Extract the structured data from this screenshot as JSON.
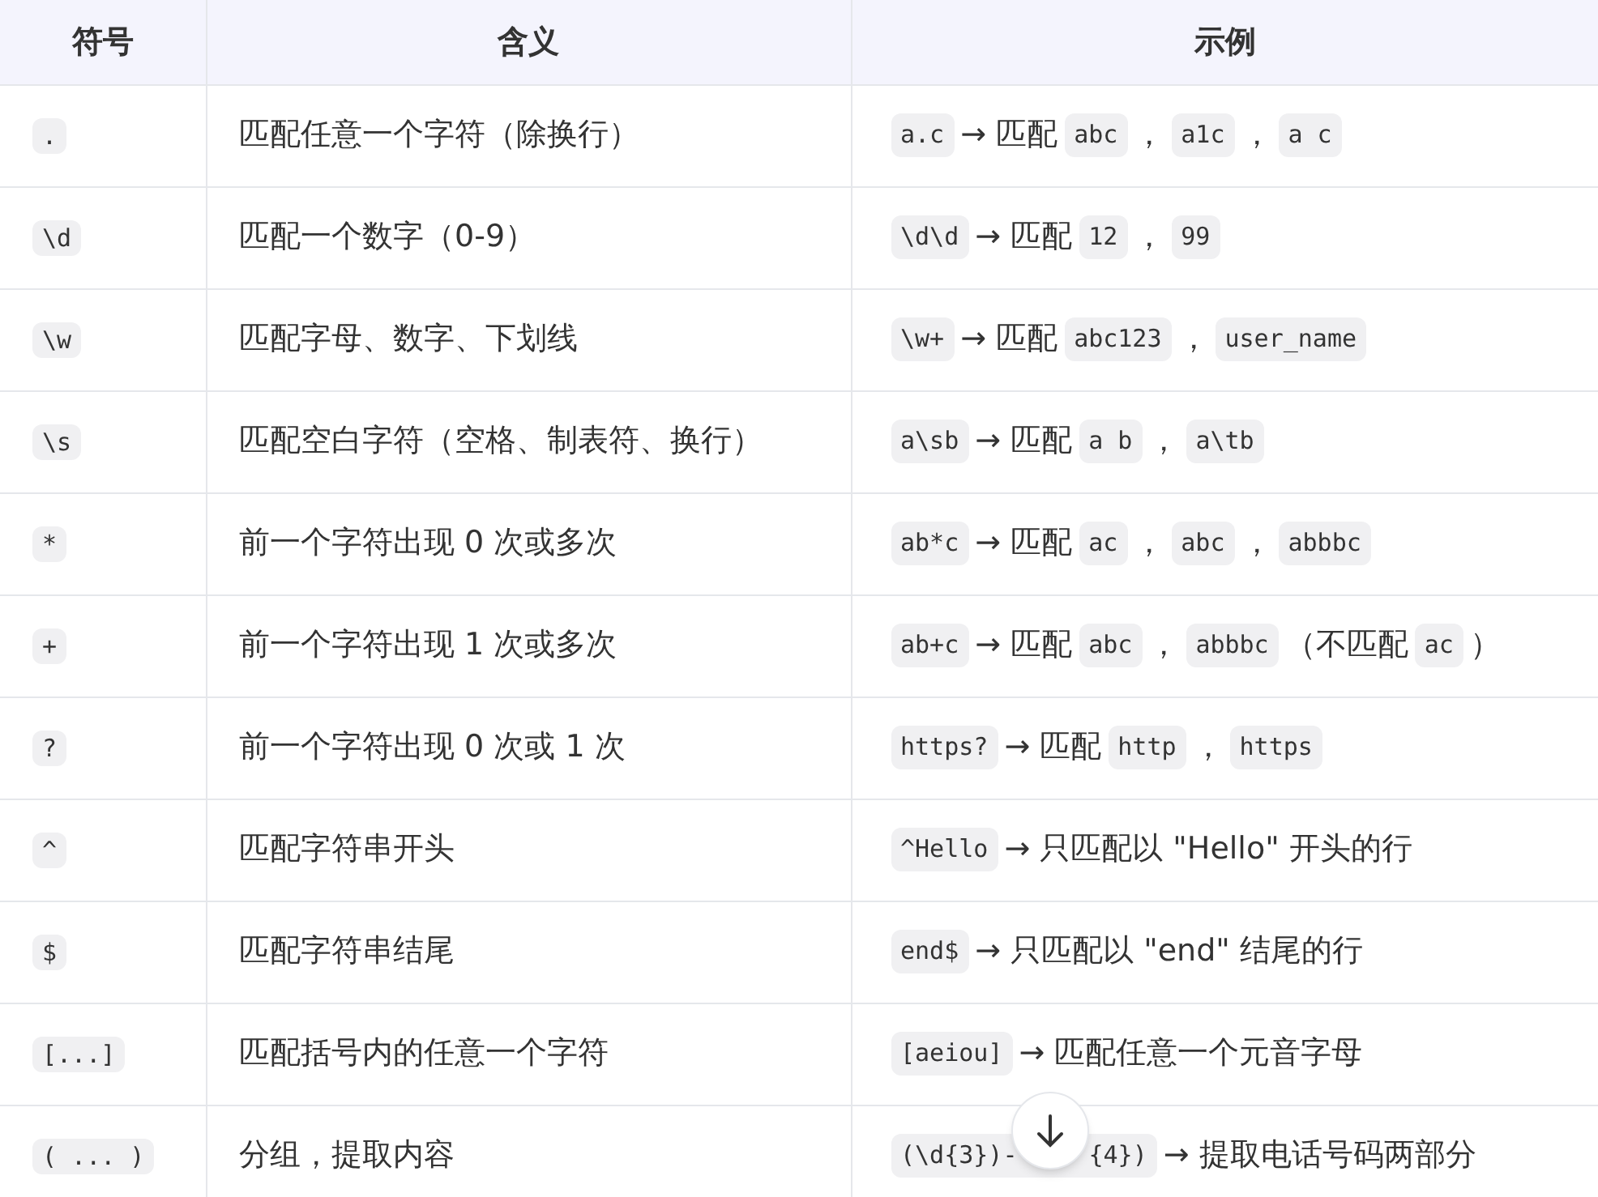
{
  "table": {
    "columns": [
      "符号",
      "含义",
      "示例"
    ],
    "rows": [
      {
        "symbol": ".",
        "meaning": "匹配任意一个字符（除换行）",
        "example": [
          {
            "kind": "code",
            "text": "a.c"
          },
          {
            "kind": "text",
            "text": "→ 匹配"
          },
          {
            "kind": "code",
            "text": "abc"
          },
          {
            "kind": "text",
            "text": "，"
          },
          {
            "kind": "code",
            "text": "a1c"
          },
          {
            "kind": "text",
            "text": "，"
          },
          {
            "kind": "code",
            "text": "a c"
          }
        ]
      },
      {
        "symbol": "\\d",
        "meaning": "匹配一个数字（0-9）",
        "example": [
          {
            "kind": "code",
            "text": "\\d\\d"
          },
          {
            "kind": "text",
            "text": "→ 匹配"
          },
          {
            "kind": "code",
            "text": "12"
          },
          {
            "kind": "text",
            "text": "，"
          },
          {
            "kind": "code",
            "text": "99"
          }
        ]
      },
      {
        "symbol": "\\w",
        "meaning": "匹配字母、数字、下划线",
        "example": [
          {
            "kind": "code",
            "text": "\\w+"
          },
          {
            "kind": "text",
            "text": "→ 匹配"
          },
          {
            "kind": "code",
            "text": "abc123"
          },
          {
            "kind": "text",
            "text": "，"
          },
          {
            "kind": "code",
            "text": "user_name"
          }
        ]
      },
      {
        "symbol": "\\s",
        "meaning": "匹配空白字符（空格、制表符、换行）",
        "example": [
          {
            "kind": "code",
            "text": "a\\sb"
          },
          {
            "kind": "text",
            "text": "→ 匹配"
          },
          {
            "kind": "code",
            "text": "a b"
          },
          {
            "kind": "text",
            "text": "，"
          },
          {
            "kind": "code",
            "text": "a\\tb"
          }
        ]
      },
      {
        "symbol": "*",
        "meaning": "前一个字符出现 0 次或多次",
        "example": [
          {
            "kind": "code",
            "text": "ab*c"
          },
          {
            "kind": "text",
            "text": "→ 匹配"
          },
          {
            "kind": "code",
            "text": "ac"
          },
          {
            "kind": "text",
            "text": "，"
          },
          {
            "kind": "code",
            "text": "abc"
          },
          {
            "kind": "text",
            "text": "，"
          },
          {
            "kind": "code",
            "text": "abbbc"
          }
        ]
      },
      {
        "symbol": "+",
        "meaning": "前一个字符出现 1 次或多次",
        "example": [
          {
            "kind": "code",
            "text": "ab+c"
          },
          {
            "kind": "text",
            "text": "→ 匹配"
          },
          {
            "kind": "code",
            "text": "abc"
          },
          {
            "kind": "text",
            "text": "，"
          },
          {
            "kind": "code",
            "text": "abbbc"
          },
          {
            "kind": "text",
            "text": "（不匹配"
          },
          {
            "kind": "code",
            "text": "ac"
          },
          {
            "kind": "text",
            "text": "）"
          }
        ]
      },
      {
        "symbol": "?",
        "meaning": "前一个字符出现 0 次或 1 次",
        "example": [
          {
            "kind": "code",
            "text": "https?"
          },
          {
            "kind": "text",
            "text": "→ 匹配"
          },
          {
            "kind": "code",
            "text": "http"
          },
          {
            "kind": "text",
            "text": "，"
          },
          {
            "kind": "code",
            "text": "https"
          }
        ]
      },
      {
        "symbol": "^",
        "meaning": "匹配字符串开头",
        "example": [
          {
            "kind": "code",
            "text": "^Hello"
          },
          {
            "kind": "text",
            "text": "→ 只匹配以 \"Hello\" 开头的行"
          }
        ]
      },
      {
        "symbol": "$",
        "meaning": "匹配字符串结尾",
        "example": [
          {
            "kind": "code",
            "text": "end$"
          },
          {
            "kind": "text",
            "text": "→ 只匹配以 \"end\" 结尾的行"
          }
        ]
      },
      {
        "symbol": "[...]",
        "meaning": "匹配括号内的任意一个字符",
        "example": [
          {
            "kind": "code",
            "text": "[aeiou]"
          },
          {
            "kind": "text",
            "text": "→ 匹配任意一个元音字母"
          }
        ]
      },
      {
        "symbol": "( ... )",
        "meaning": "分组，提取内容",
        "example": [
          {
            "kind": "code",
            "text": "(\\d{3})-",
            "tail": "{4})"
          },
          {
            "kind": "text",
            "text": "→ 提取电话号码两部分"
          }
        ]
      }
    ]
  }
}
